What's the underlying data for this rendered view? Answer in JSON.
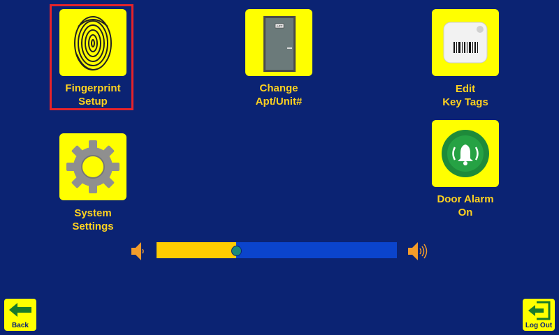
{
  "tiles": {
    "fingerprint": {
      "label": "Fingerprint\nSetup"
    },
    "change_apt": {
      "label": "Change\nApt/Unit#",
      "door_sign": "APT"
    },
    "edit_tags": {
      "label": "Edit\nKey Tags"
    },
    "system_settings": {
      "label": "System\nSettings"
    },
    "door_alarm": {
      "label": "Door Alarm\nOn"
    }
  },
  "volume": {
    "level": 0.33
  },
  "nav": {
    "back_label": "Back",
    "logout_label": "Log Out"
  },
  "colors": {
    "background": "#0b2373",
    "tile": "#ffff00",
    "label": "#ffd21f",
    "selection": "#e5232a",
    "volume_fill": "#ffcc00",
    "volume_track": "#0b44cc"
  }
}
